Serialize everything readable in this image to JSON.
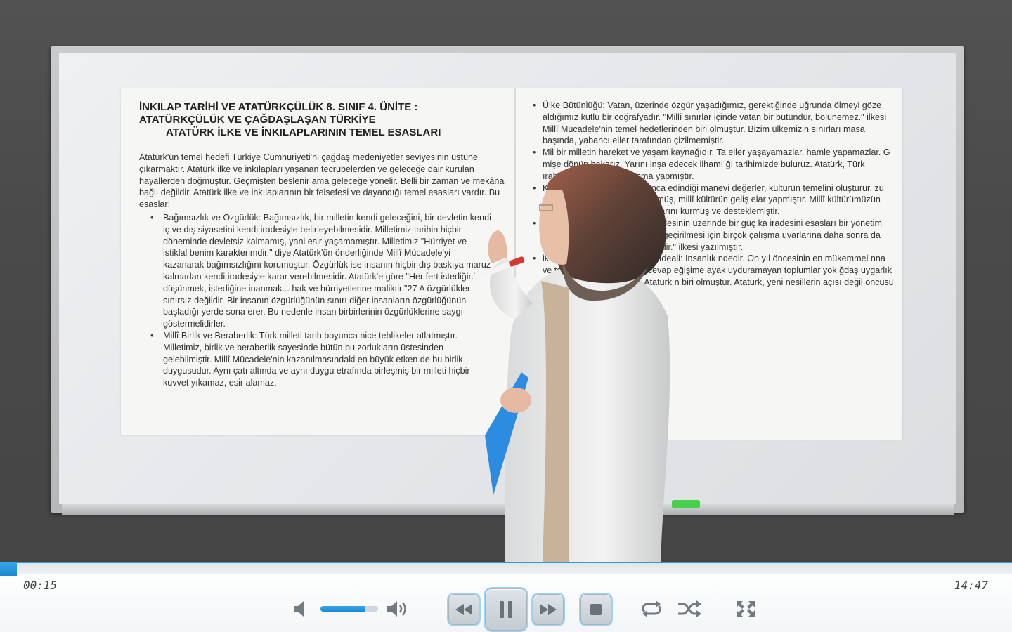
{
  "player": {
    "current_time": "00:15",
    "total_time": "14:47",
    "progress_fraction": 0.017,
    "volume_fraction": 0.78,
    "accent_color": "#2b9ce0",
    "state": "playing"
  },
  "controls": {
    "mute_icon": "speaker-low-icon",
    "volume_up_icon": "speaker-high-icon",
    "rewind_icon": "rewind-icon",
    "pause_icon": "pause-icon",
    "forward_icon": "fast-forward-icon",
    "stop_icon": "stop-icon",
    "repeat_icon": "repeat-icon",
    "shuffle_icon": "shuffle-icon",
    "fullscreen_icon": "fullscreen-icon"
  },
  "board": {
    "left": {
      "title_line1": "İNKILAP TARİHİ VE ATATÜRKÇÜLÜK 8. SINIF 4. ÜNİTE :",
      "title_line2": "ATATÜRKÇÜLÜK VE ÇAĞDAŞLAŞAN TÜRKİYE",
      "title_line3": "ATATÜRK İLKE VE İNKILAPLARININ TEMEL ESASLARI",
      "intro": "Atatürk'ün temel hedefi Türkiye Cumhuriyeti'ni çağdaş medeniyetler seviyesinin üstüne çıkarmaktır. Atatürk ilke ve inkılapları yaşanan tecrübelerden ve geleceğe dair kurulan hayallerden doğmuştur. Geçmişten beslenir ama geleceğe yönelir. Belli bir zaman ve mekâna bağlı değildir. Atatürk ilke ve inkılaplarının bir felsefesi ve dayandığı temel esasları vardır. Bu esaslar:",
      "items": [
        "Bağımsızlık ve Özgürlük: Bağımsızlık, bir milletin kendi geleceğini, bir devletin kendi iç ve dış siyasetini kendi iradesiyle belirleyebilmesidir. Milletimiz tarihin hiçbir döneminde devletsiz kalmamış, yani esir yaşamamıştır. Milletimiz \"Hürriyet ve istiklal benim karakterimdir.\" diye Atatürk'ün önderliğinde Millî Mücadele'yi kazanarak bağımsızlığını korumuştur. Özgürlük ise insanın hiçbir dış baskıya maruz kalmadan kendi iradesiyle karar verebilmesidir. Atatürk'e göre \"Her fert istediğini düşünmek, istediğine inanmak... hak ve hürriyetlerine maliktir.\"27 A özgürlükler sınırsız değildir. Bir insanın özgürlüğünün sınırı diğer insanların özgürlüğünün başladığı yerde sona erer. Bu nedenle insan birbirlerinin özgürlüklerine saygı göstermelidirler.",
        "Millî Birlik ve Beraberlik: Türk milleti tarih boyunca nice tehlikeler atlatmıştır. Milletimiz, birlik ve beraberlik sayesinde bütün bu zorlukların üstesinden gelebilmiştir. Millî Mücadele'nin kazanılmasındaki en büyük etken de bu birlik duygusudur. Aynı çatı altında ve aynı duygu etrafında birleşmiş bir milleti hiçbir kuvvet yıkamaz, esir alamaz."
      ]
    },
    "right": {
      "items": [
        "Ülke Bütünlüğü: Vatan, üzerinde özgür yaşadığımız, gerektiğinde uğrunda ölmeyi göze aldığımız kutlu bir coğrafyadır. \"Millî sınırlar içinde vatan bir bütündür, bölünemez.\" ilkesi Millî Mücadele'nin temel hedeflerinden biri olmuştur. Bizim ülkemizin sınırları masa başında, yabancı eller tarafından çizilmemiştir.",
        "Mil bir milletin hareket ve yaşam kaynağıdır. Ta eller yaşayamazlar, hamle yapamazlar. G mişe dönüp bakarız. Yarını inşa edecek ilhamı ğı tarihimizde buluruz. Atatürk, Türk ırabilmek için birçok çalışma yapmıştır.",
        "Kültür, bir milletin tarih boyunca edindiği manevi değerler, kültürün temelini oluşturur. zu devletimizin temeli olarak görmüş, millî kültürün geliş elar yapmıştır. Millî kültürümüzün zenginliğini orta e tarih kurumlarını kurmuş ve desteklemiştir.",
        "Eger Olması: Atatürk, millet iradesinin üzerinde bir güç ka iradesini esasları bir yönetim oluşturmayı temel enin hayata geçirilmesi için birçok çalışma uvarlarına daha sonra da hazırlanan ısız, şartsız milletindir.\" ilkesi yazılmıştır.",
        "ik Düzeyinin Üstüne Çıkarma İdeali: İnsanlık ndedir. On yıl öncesinin en mükemmel nna ve toplumun beklentilerine cevap eğişime ayak uyduramayan toplumlar yok ğdaş uygarlık düzeyinin üstüne çıkmak, Atatürk n biri olmuştur. Atatürk, yeni nesillerin açısı değil öncüsü olmasını istemiştir."
      ]
    }
  }
}
